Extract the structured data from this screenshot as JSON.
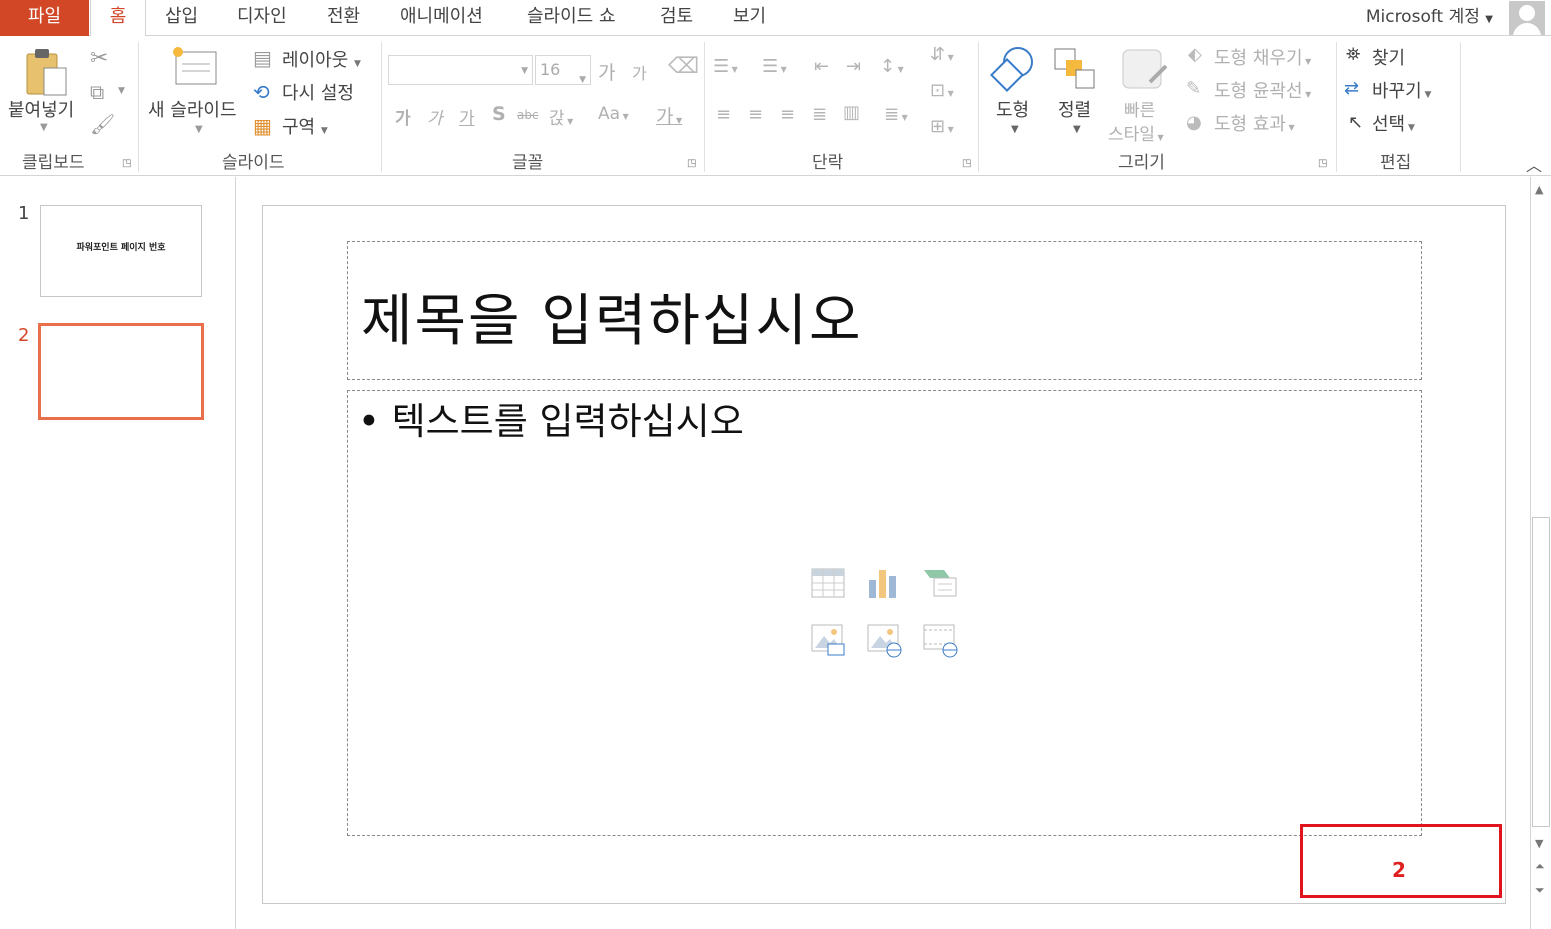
{
  "tabs": {
    "file": "파일",
    "home": "홈",
    "insert": "삽입",
    "design": "디자인",
    "transitions": "전환",
    "animations": "애니메이션",
    "slideshow": "슬라이드 쇼",
    "review": "검토",
    "view": "보기"
  },
  "account": "Microsoft 계정",
  "ribbon": {
    "clipboard": {
      "paste": "붙여넣기",
      "label": "클립보드"
    },
    "slides": {
      "new_slide": "새 슬라이드",
      "layout": "레이아웃",
      "reset": "다시 설정",
      "section": "구역",
      "label": "슬라이드"
    },
    "font": {
      "size": "16",
      "grow": "가",
      "shrink": "가",
      "bold": "가",
      "italic": "가",
      "underline": "가",
      "shadow": "S",
      "strike": "abc",
      "spacing": "갅",
      "case": "Aa",
      "color": "가",
      "label": "글꼴"
    },
    "paragraph": {
      "label": "단락"
    },
    "drawing": {
      "shapes": "도형",
      "arrange": "정렬",
      "quick_styles_1": "빠른",
      "quick_styles_2": "스타일",
      "fill": "도형 채우기",
      "outline": "도형 윤곽선",
      "effects": "도형 효과",
      "label": "그리기"
    },
    "editing": {
      "find": "찾기",
      "replace": "바꾸기",
      "select": "선택",
      "label": "편집"
    }
  },
  "thumbnails": [
    {
      "number": "1",
      "title": "파워포인트 페이지 번호"
    },
    {
      "number": "2",
      "title": ""
    }
  ],
  "slide": {
    "title_placeholder": "제목을 입력하십시오",
    "body_placeholder": "• 텍스트를 입력하십시오",
    "page_number": "2"
  },
  "colors": {
    "accent": "#d24726",
    "selected_thumb": "#e86f4a",
    "highlight": "#e0141c"
  }
}
